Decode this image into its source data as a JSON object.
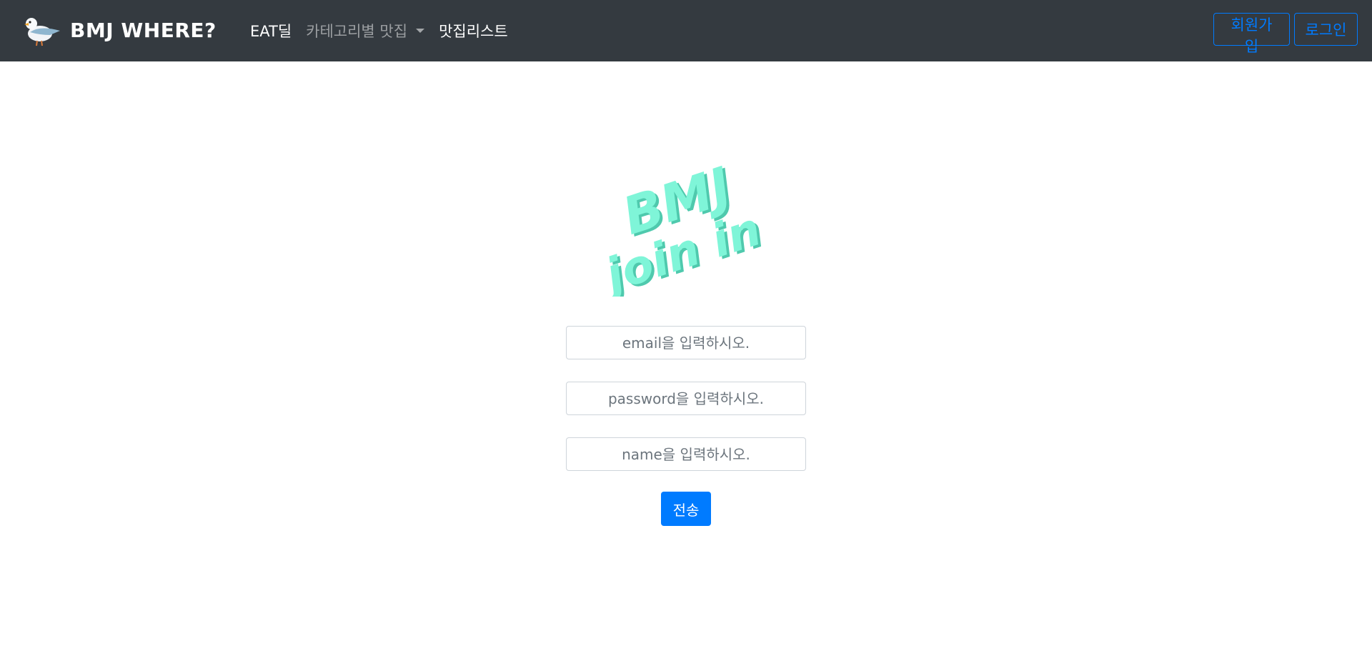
{
  "brand": {
    "icon": "seagull-icon",
    "title": "BMJ WHERE?"
  },
  "nav": {
    "links": [
      {
        "label": "EAT딜"
      },
      {
        "label": "카테고리별 맛집"
      },
      {
        "label": "맛집리스트"
      }
    ],
    "signup_label": "회원가입",
    "login_label": "로그인"
  },
  "hero": {
    "logo_text_1": "BMJ",
    "logo_text_2": "join in",
    "logo_color": "#7ff5d8"
  },
  "form": {
    "email_placeholder": "email을 입력하시오.",
    "password_placeholder": "password을 입력하시오.",
    "name_placeholder": "name을 입력하시오.",
    "submit_label": "전송"
  },
  "colors": {
    "navbar_bg": "#343a40",
    "primary": "#007bff"
  }
}
